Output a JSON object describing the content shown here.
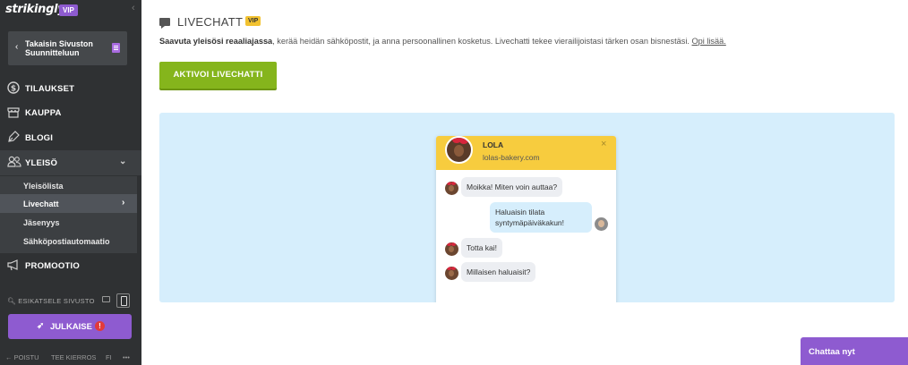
{
  "sidebar": {
    "logo": "strikingly",
    "vip": "VIP",
    "back_label": "Takaisin Sivuston Suunnitteluun",
    "nav": {
      "orders": "TILAUKSET",
      "store": "KAUPPA",
      "blog": "BLOGI",
      "audience": "YLEISÖ",
      "promotion": "PROMOOTIO"
    },
    "sub": {
      "audience_list": "Yleisölista",
      "livechat": "Livechatt",
      "membership": "Jäsenyys",
      "email_automation": "Sähköpostiautomaatio"
    },
    "preview_label": "ESIKATSELE SIVUSTO",
    "publish_label": "JULKAISE",
    "publish_warning": "!",
    "footer": {
      "exit": "← POISTU",
      "tour": "TEE KIERROS",
      "lang": "FI",
      "more": "•••"
    }
  },
  "main": {
    "title": "LIVECHATT",
    "vip": "VIP",
    "desc_bold": "Saavuta yleisösi reaaliajassa",
    "desc_rest": ", kerää heidän sähköpostit, ja anna persoonallinen kosketus. Livechatti tekee vierailijoistasi tärken osan bisnestäsi. ",
    "desc_link": "Opi lisää.",
    "activate_label": "AKTIVOI LIVECHATTI"
  },
  "widget": {
    "agent_name": "LOLA",
    "agent_site": "lolas-bakery.com",
    "close": "×",
    "messages": [
      "Moikka! Miten voin auttaa?",
      "Haluaisin tilata syntymäpäiväkakun!",
      "Totta kai!",
      "Millaisen haluaisit?"
    ]
  },
  "chat_now": "Chattaa nyt",
  "colors": {
    "sidebar_bg": "#2f3133",
    "accent_purple": "#8e5bd0",
    "activate_green": "#85b51c",
    "vip_yellow": "#f2c230",
    "preview_bg": "#d6eefc",
    "widget_header": "#f7cc3e"
  },
  "icons": {
    "orders": "dollar-circle-icon",
    "store": "storefront-icon",
    "blog": "pen-nib-icon",
    "audience": "people-icon",
    "promotion": "megaphone-icon"
  }
}
